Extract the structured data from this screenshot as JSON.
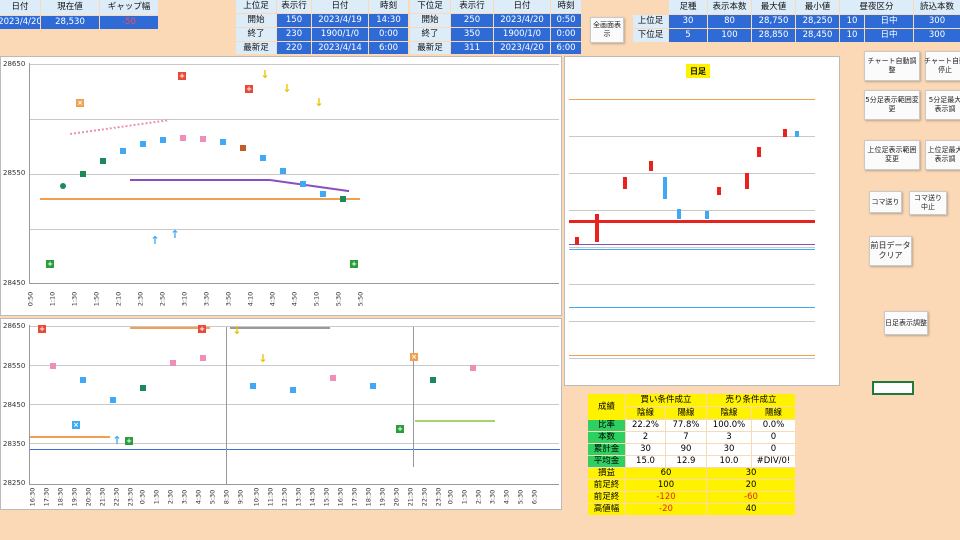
{
  "topLeft": {
    "h": [
      "日付",
      "現在値",
      "ギャップ幅"
    ],
    "v": [
      "2023/4/20",
      "28,530",
      "-50"
    ]
  },
  "upperRange": {
    "title": "上位足",
    "hrow": "表示行",
    "hdate": "日付",
    "htime": "時刻",
    "rows": [
      {
        "label": "開始",
        "row": "150",
        "date": "2023/4/19",
        "time": "14:30"
      },
      {
        "label": "終了",
        "row": "230",
        "date": "1900/1/0",
        "time": "0:00"
      },
      {
        "label": "最新足",
        "row": "220",
        "date": "2023/4/14",
        "time": "6:00"
      }
    ]
  },
  "lowerRange": {
    "title": "下位足",
    "hrow": "表示行",
    "hdate": "日付",
    "htime": "時刻",
    "rows": [
      {
        "label": "開始",
        "row": "250",
        "date": "2023/4/20",
        "time": "0:50"
      },
      {
        "label": "終了",
        "row": "350",
        "date": "1900/1/0",
        "time": "0:00"
      },
      {
        "label": "最新足",
        "row": "311",
        "date": "2023/4/20",
        "time": "6:00"
      }
    ]
  },
  "fullscreen": "全画面表示",
  "summary": {
    "headers": [
      "足種",
      "表示本数",
      "最大値",
      "最小値",
      "昼夜区分",
      "読込本数"
    ],
    "rows": [
      {
        "label": "上位足",
        "v": [
          "30",
          "80",
          "28,750",
          "28,250",
          "10",
          "日中",
          "300"
        ]
      },
      {
        "label": "下位足",
        "v": [
          "5",
          "100",
          "28,850",
          "28,450",
          "10",
          "日中",
          "300"
        ]
      }
    ]
  },
  "buttons": {
    "auto": "チャート自動調整",
    "autoStop": "チャート自動\n停止",
    "min5": "5分足表示範囲変更",
    "min5b": "5分足最大\n表示調",
    "upper": "上位足表示範囲変更",
    "upperB": "上位足最大\n表示調",
    "step": "コマ送り",
    "stepStop": "コマ送り\n中止",
    "clear": "前日データ\nクリア",
    "dailyAdj": "日足表示調整"
  },
  "chart1": {
    "yTicks": [
      "28650",
      "28550",
      "28450"
    ],
    "xTicks": [
      "0:50",
      "1:10",
      "1:30",
      "1:50",
      "2:10",
      "2:30",
      "2:50",
      "3:10",
      "3:30",
      "3:50",
      "4:10",
      "4:30",
      "4:50",
      "5:10",
      "5:30",
      "5:50"
    ]
  },
  "chart2": {
    "yTicks": [
      "28650",
      "28550",
      "28450",
      "28350",
      "28250"
    ],
    "xTicks": [
      "16:30",
      "17:30",
      "18:30",
      "19:30",
      "20:30",
      "21:30",
      "22:30",
      "23:30",
      "0:30",
      "1:30",
      "2:30",
      "3:30",
      "4:30",
      "5:30",
      "8:30",
      "9:30",
      "10:30",
      "11:30",
      "12:30",
      "13:30",
      "14:30",
      "15:30",
      "16:30",
      "17:30",
      "18:30",
      "19:30",
      "20:30",
      "21:30",
      "22:30",
      "23:30",
      "0:30",
      "1:30",
      "2:30",
      "3:30",
      "4:30",
      "5:30",
      "6:30"
    ]
  },
  "daily": {
    "title": "日足"
  },
  "score": {
    "title": "成績",
    "buy": "買い条件成立",
    "sell": "売り条件成立",
    "sub": [
      "陰線",
      "陽線",
      "陰線",
      "陽線"
    ],
    "rows": [
      {
        "label": "比率",
        "v": [
          "22.2%",
          "77.8%",
          "100.0%",
          "0.0%"
        ]
      },
      {
        "label": "本数",
        "v": [
          "2",
          "7",
          "3",
          "0"
        ]
      },
      {
        "label": "累計金",
        "v": [
          "30",
          "90",
          "30",
          "0"
        ]
      },
      {
        "label": "平均金",
        "v": [
          "15.0",
          "12.9",
          "10.0",
          "#DIV/0!"
        ]
      }
    ],
    "rows2": [
      {
        "label": "損益",
        "v": [
          "60",
          "30"
        ]
      },
      {
        "label": "前足終",
        "v": [
          "100",
          "20"
        ]
      },
      {
        "label": "前足終",
        "v": [
          "-120",
          "-60"
        ]
      },
      {
        "label": "高値幅",
        "v": [
          "-20",
          "40"
        ]
      }
    ]
  },
  "colors": {
    "blue": "#2f6bd6",
    "header": "#dcecf9",
    "yellow": "#fff200",
    "green": "#2ed062"
  }
}
